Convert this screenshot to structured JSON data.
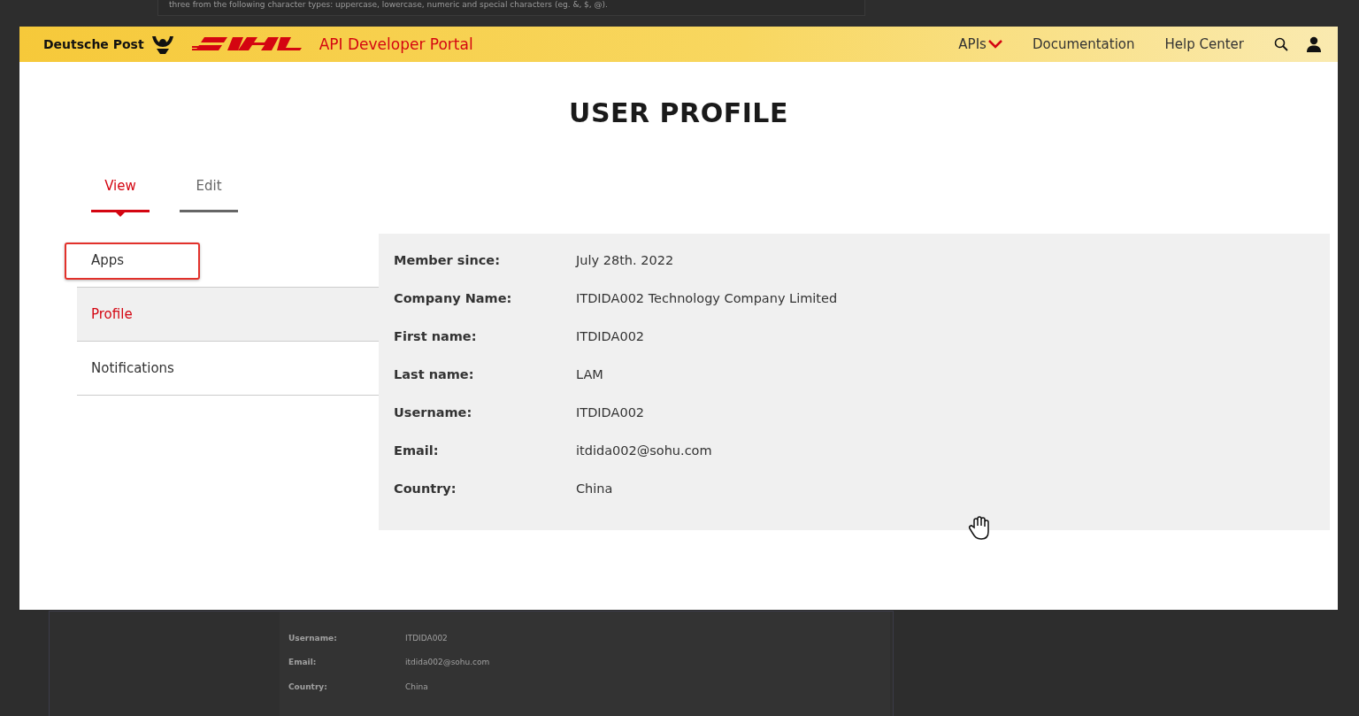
{
  "background_page": {
    "note": "three from the following character types: uppercase, lowercase, numeric and special characters (eg. &, $, @).",
    "rows": [
      {
        "label": "Username:",
        "value": "ITDIDA002"
      },
      {
        "label": "Email:",
        "value": "itdida002@sohu.com"
      },
      {
        "label": "Country:",
        "value": "China"
      }
    ]
  },
  "header": {
    "brand": "Deutsche Post",
    "portal_title": "API Developer Portal",
    "nav": [
      {
        "label": "APIs",
        "kind": "dropdown"
      },
      {
        "label": "Documentation",
        "kind": "link"
      },
      {
        "label": "Help Center",
        "kind": "link"
      }
    ]
  },
  "page_title": "USER PROFILE",
  "tabs": [
    {
      "label": "View",
      "selected": true
    },
    {
      "label": "Edit",
      "selected": false
    }
  ],
  "sidebar": {
    "items": [
      {
        "label": "Apps",
        "selected": false,
        "highlighted": true
      },
      {
        "label": "Profile",
        "selected": true,
        "highlighted": false
      },
      {
        "label": "Notifications",
        "selected": false,
        "highlighted": false
      }
    ]
  },
  "profile": [
    {
      "label": "Member since:",
      "value": "July 28th. 2022"
    },
    {
      "label": "Company Name:",
      "value": "ITDIDA002 Technology Company Limited"
    },
    {
      "label": "First name:",
      "value": "ITDIDA002"
    },
    {
      "label": "Last name:",
      "value": "LAM"
    },
    {
      "label": "Username:",
      "value": "ITDIDA002"
    },
    {
      "label": "Email:",
      "value": "itdida002@sohu.com"
    },
    {
      "label": "Country:",
      "value": "China"
    }
  ]
}
